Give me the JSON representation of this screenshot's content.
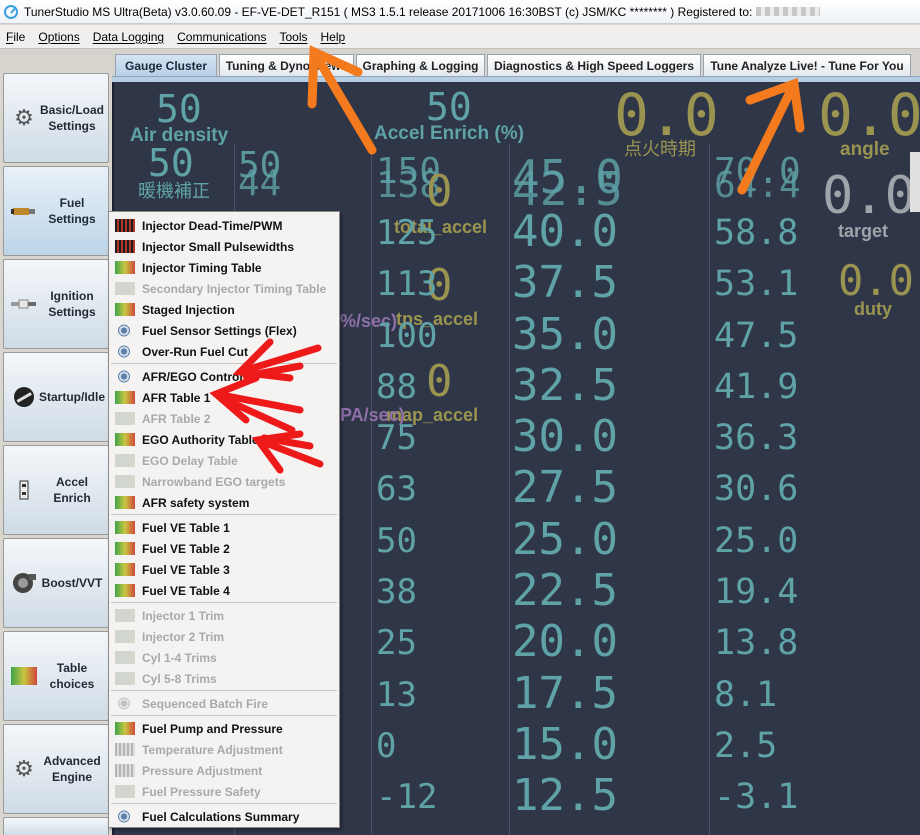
{
  "window": {
    "title": "TunerStudio MS Ultra(Beta) v3.0.60.09 - EF-VE-DET_R151 ( MS3 1.5.1 release     20171006 16:30BST (c) JSM/KC ******** ) Registered to:"
  },
  "menu": [
    "File",
    "Options",
    "Data Logging",
    "Communications",
    "Tools",
    "Help"
  ],
  "tabs": [
    "Gauge Cluster",
    "Tuning & Dyno Views",
    "Graphing & Logging",
    "Diagnostics & High Speed Loggers",
    "Tune Analyze Live! - Tune For You"
  ],
  "sidebar": [
    {
      "label": "Basic/Load\nSettings",
      "icon": "gear-icon"
    },
    {
      "label": "Fuel\nSettings",
      "icon": "fuel-injector-icon"
    },
    {
      "label": "Ignition\nSettings",
      "icon": "spark-plug-icon"
    },
    {
      "label": "Startup/Idle",
      "icon": "idle-dial-icon"
    },
    {
      "label": "Accel Enrich",
      "icon": "accel-icon"
    },
    {
      "label": "Boost/VVT",
      "icon": "turbo-icon"
    },
    {
      "label": "Table\nchoices",
      "icon": "table-icon"
    },
    {
      "label": "Advanced\nEngine",
      "icon": "advanced-gears-icon"
    }
  ],
  "fuel_menu": [
    {
      "label": "Injector Dead-Time/PWM",
      "enabled": true,
      "icon": "dead-time-icon"
    },
    {
      "label": "Injector Small Pulsewidths",
      "enabled": true,
      "icon": "dead-time-icon"
    },
    {
      "label": "Injector Timing Table",
      "enabled": true,
      "icon": "table-icon"
    },
    {
      "label": "Secondary Injector Timing Table",
      "enabled": false,
      "icon": "table-icon"
    },
    {
      "label": "Staged Injection",
      "enabled": true,
      "icon": "table-icon"
    },
    {
      "label": "Fuel Sensor Settings (Flex)",
      "enabled": true,
      "icon": "settings-icon"
    },
    {
      "label": "Over-Run Fuel Cut",
      "enabled": true,
      "icon": "settings-icon"
    },
    {
      "label": "AFR/EGO Control",
      "enabled": true,
      "icon": "settings-icon"
    },
    {
      "label": "AFR Table 1",
      "enabled": true,
      "icon": "table-icon"
    },
    {
      "label": "AFR Table 2",
      "enabled": false,
      "icon": "table-icon"
    },
    {
      "label": "EGO Authority Table",
      "enabled": true,
      "icon": "table-icon"
    },
    {
      "label": "EGO Delay Table",
      "enabled": false,
      "icon": "table-icon"
    },
    {
      "label": "Narrowband EGO targets",
      "enabled": false,
      "icon": "table-icon"
    },
    {
      "label": "AFR safety system",
      "enabled": true,
      "icon": "table-icon"
    },
    {
      "label": "Fuel VE Table 1",
      "enabled": true,
      "icon": "table-icon"
    },
    {
      "label": "Fuel VE Table 2",
      "enabled": true,
      "icon": "table-icon"
    },
    {
      "label": "Fuel VE Table 3",
      "enabled": true,
      "icon": "table-icon"
    },
    {
      "label": "Fuel VE Table 4",
      "enabled": true,
      "icon": "table-icon"
    },
    {
      "label": "Injector 1 Trim",
      "enabled": false,
      "icon": "table-icon"
    },
    {
      "label": "Injector 2 Trim",
      "enabled": false,
      "icon": "table-icon"
    },
    {
      "label": "Cyl 1-4 Trims",
      "enabled": false,
      "icon": "table-icon"
    },
    {
      "label": "Cyl 5-8 Trims",
      "enabled": false,
      "icon": "table-icon"
    },
    {
      "label": "Sequenced Batch Fire",
      "enabled": false,
      "icon": "settings-icon"
    },
    {
      "label": "Fuel Pump and Pressure",
      "enabled": true,
      "icon": "table-icon"
    },
    {
      "label": "Temperature Adjustment",
      "enabled": false,
      "icon": "grid-icon"
    },
    {
      "label": "Pressure Adjustment",
      "enabled": false,
      "icon": "grid-icon"
    },
    {
      "label": "Fuel Pressure Safety",
      "enabled": false,
      "icon": "table-icon"
    },
    {
      "label": "Fuel Calculations Summary",
      "enabled": true,
      "icon": "settings-icon"
    }
  ],
  "gauges": {
    "air_density_value": "50",
    "air_density_label": "Air density",
    "accel_enrich_value": "50",
    "accel_enrich_label": "Accel Enrich (%)",
    "ignition_timing_value": "0.0",
    "ignition_timing_label": "点火時期",
    "angle_value": "0.0",
    "angle_label": "angle",
    "warmup_value": "50",
    "warmup_label": "暖機補正",
    "target_value": "0.0",
    "target_label": "target",
    "duty_value": "0.0",
    "duty_label": "duty",
    "total_accel_value": "0",
    "total_accel_label": "total_accel",
    "tps_accel_value": "0",
    "tps_accel_label": "tps_accel",
    "map_accel_value": "0",
    "map_accel_label": "map_accel",
    "tps_rate_unit": "%/sec)",
    "map_rate_unit": "PA/sec)",
    "col1_overlap_a": "50",
    "col1_overlap_b": "44",
    "col2_overlap_a": "150",
    "col2_overlap_b": "138",
    "col3_overlap_a": "45.0",
    "col3_overlap_b": "42.5",
    "col4_overlap_a": "70.0",
    "col4_overlap_b": "64.4"
  },
  "scale_columns": {
    "col2": [
      "125",
      "113",
      "100",
      "88",
      "75",
      "63",
      "50",
      "38",
      "25",
      "13",
      "0",
      "-12"
    ],
    "col3": [
      "40.0",
      "37.5",
      "35.0",
      "32.5",
      "30.0",
      "27.5",
      "25.0",
      "22.5",
      "20.0",
      "17.5",
      "15.0",
      "12.5"
    ],
    "col4": [
      "58.8",
      "53.1",
      "47.5",
      "41.9",
      "36.3",
      "30.6",
      "25.0",
      "19.4",
      "13.8",
      "8.1",
      "2.5",
      "-3.1"
    ]
  },
  "colors": {
    "gauge_bg": "#2f3648",
    "teal_text": "#5fa3a8",
    "olive_text": "#9a9450",
    "annotation_red": "#ee1a1a",
    "annotation_orange": "#f47a1e"
  }
}
